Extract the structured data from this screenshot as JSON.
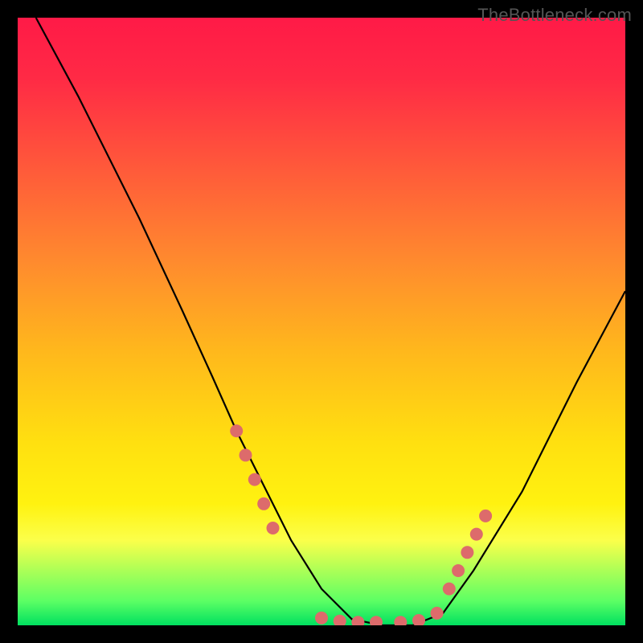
{
  "watermark": "TheBottleneck.com",
  "chart_data": {
    "type": "line",
    "title": "",
    "xlabel": "",
    "ylabel": "",
    "xlim": [
      0,
      100
    ],
    "ylim": [
      0,
      100
    ],
    "series": [
      {
        "name": "curve",
        "x": [
          3,
          10,
          20,
          27,
          32,
          36,
          40,
          45,
          50,
          55,
          60,
          65,
          70,
          75,
          83,
          92,
          100
        ],
        "y": [
          100,
          87,
          67,
          52,
          41,
          32,
          24,
          14,
          6,
          1,
          0,
          0,
          2,
          9,
          22,
          40,
          55
        ]
      }
    ],
    "markers": {
      "name": "dots",
      "color": "#dd6b6b",
      "x": [
        36,
        37.5,
        39,
        40.5,
        42,
        50,
        53,
        56,
        59,
        63,
        66,
        69,
        71,
        72.5,
        74,
        75.5,
        77
      ],
      "y": [
        32,
        28,
        24,
        20,
        16,
        1.2,
        0.7,
        0.5,
        0.5,
        0.5,
        0.8,
        2,
        6,
        9,
        12,
        15,
        18
      ]
    },
    "background_gradient": [
      "#ff1a47",
      "#ffb81c",
      "#fff210",
      "#00e060"
    ]
  }
}
